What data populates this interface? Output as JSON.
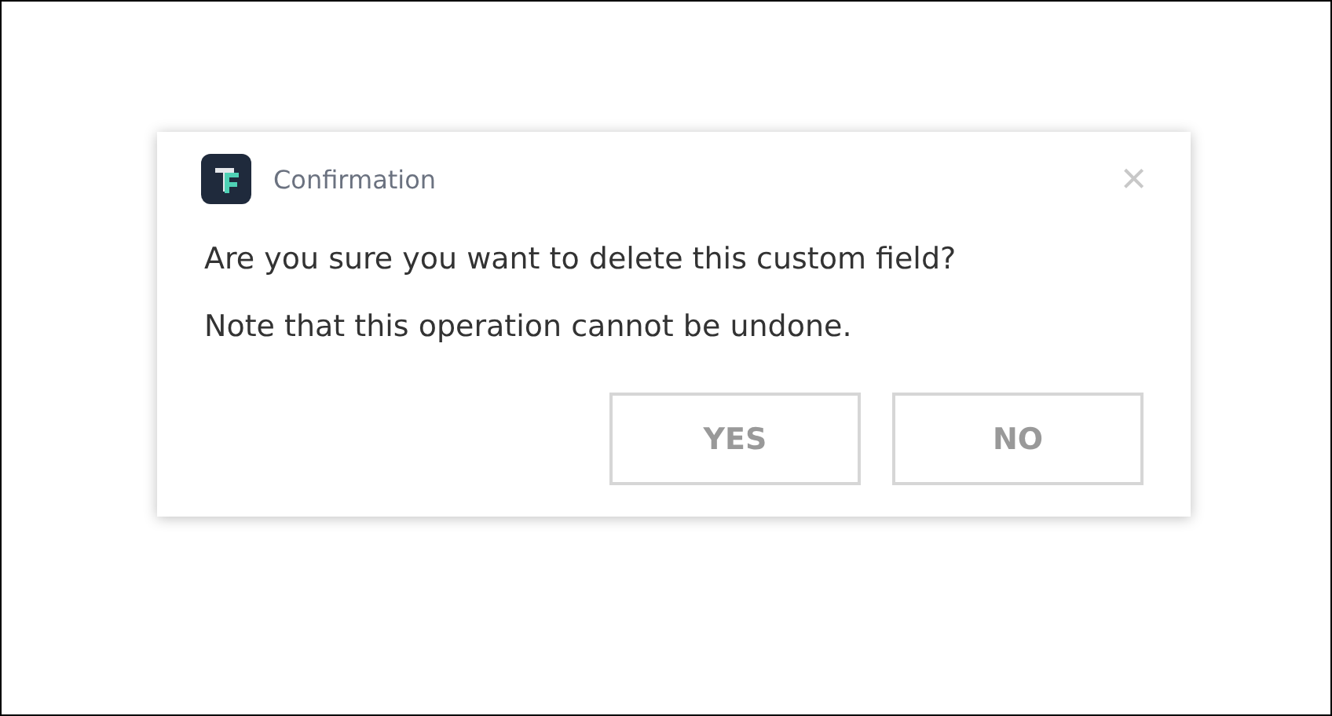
{
  "dialog": {
    "title": "Confirmation",
    "close": "×",
    "message": [
      "Are you sure you want to delete this custom field?",
      "Note that this operation cannot be undone."
    ],
    "buttons": [
      "YES",
      "NO"
    ]
  }
}
